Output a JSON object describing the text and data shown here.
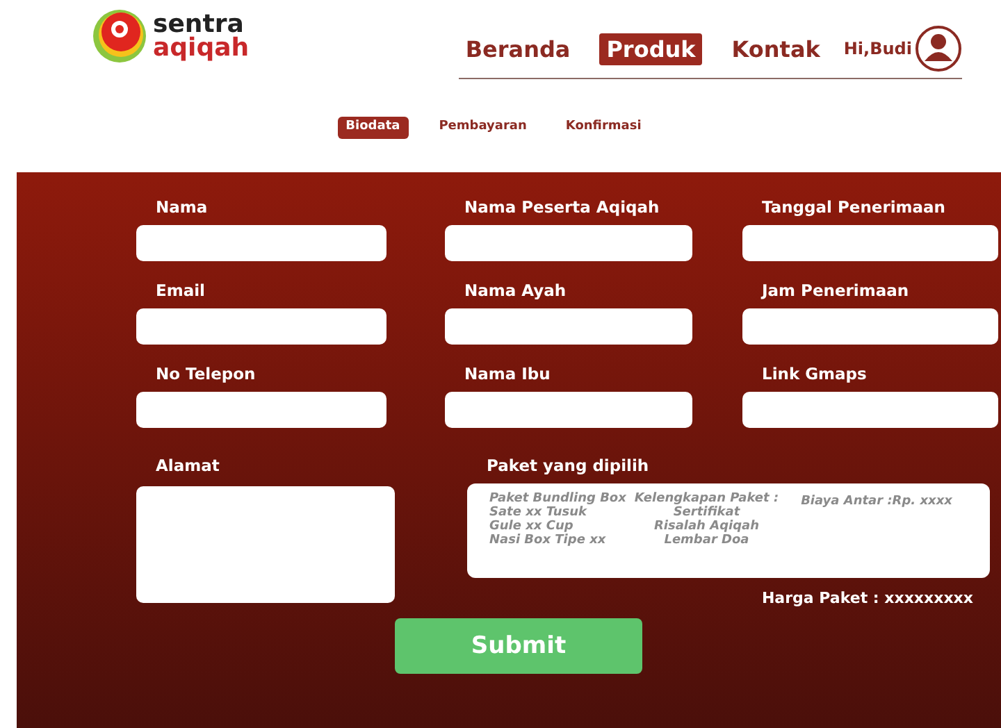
{
  "logo": {
    "line1": "sentra",
    "line2": "aqiqah"
  },
  "nav": [
    {
      "label": "Beranda",
      "selected": false
    },
    {
      "label": "Produk",
      "selected": true
    },
    {
      "label": "Kontak",
      "selected": false
    }
  ],
  "user": {
    "greeting": "Hi,Budi"
  },
  "steps": [
    {
      "label": "Biodata",
      "selected": true
    },
    {
      "label": "Pembayaran",
      "selected": false
    },
    {
      "label": "Konfirmasi",
      "selected": false
    }
  ],
  "form": {
    "fields": [
      {
        "label": "Nama"
      },
      {
        "label": "Nama Peserta Aqiqah"
      },
      {
        "label": "Tanggal Penerimaan"
      },
      {
        "label": "Email"
      },
      {
        "label": "Nama Ayah"
      },
      {
        "label": "Jam Penerimaan"
      },
      {
        "label": "No Telepon"
      },
      {
        "label": "Nama Ibu"
      },
      {
        "label": "Link Gmaps"
      }
    ],
    "address": {
      "label": "Alamat"
    },
    "package": {
      "label": "Paket yang dipilih",
      "columns": [
        [
          "Paket Bundling Box",
          "Sate xx Tusuk",
          "Gule xx Cup",
          "Nasi Box Tipe xx"
        ],
        [
          "Kelengkapan Paket :",
          "Sertifikat",
          "Risalah Aqiqah",
          "Lembar Doa"
        ],
        [
          "Biaya Antar :Rp. xxxx"
        ]
      ]
    },
    "price": "Harga Paket : xxxxxxxxx",
    "submit": "Submit"
  }
}
